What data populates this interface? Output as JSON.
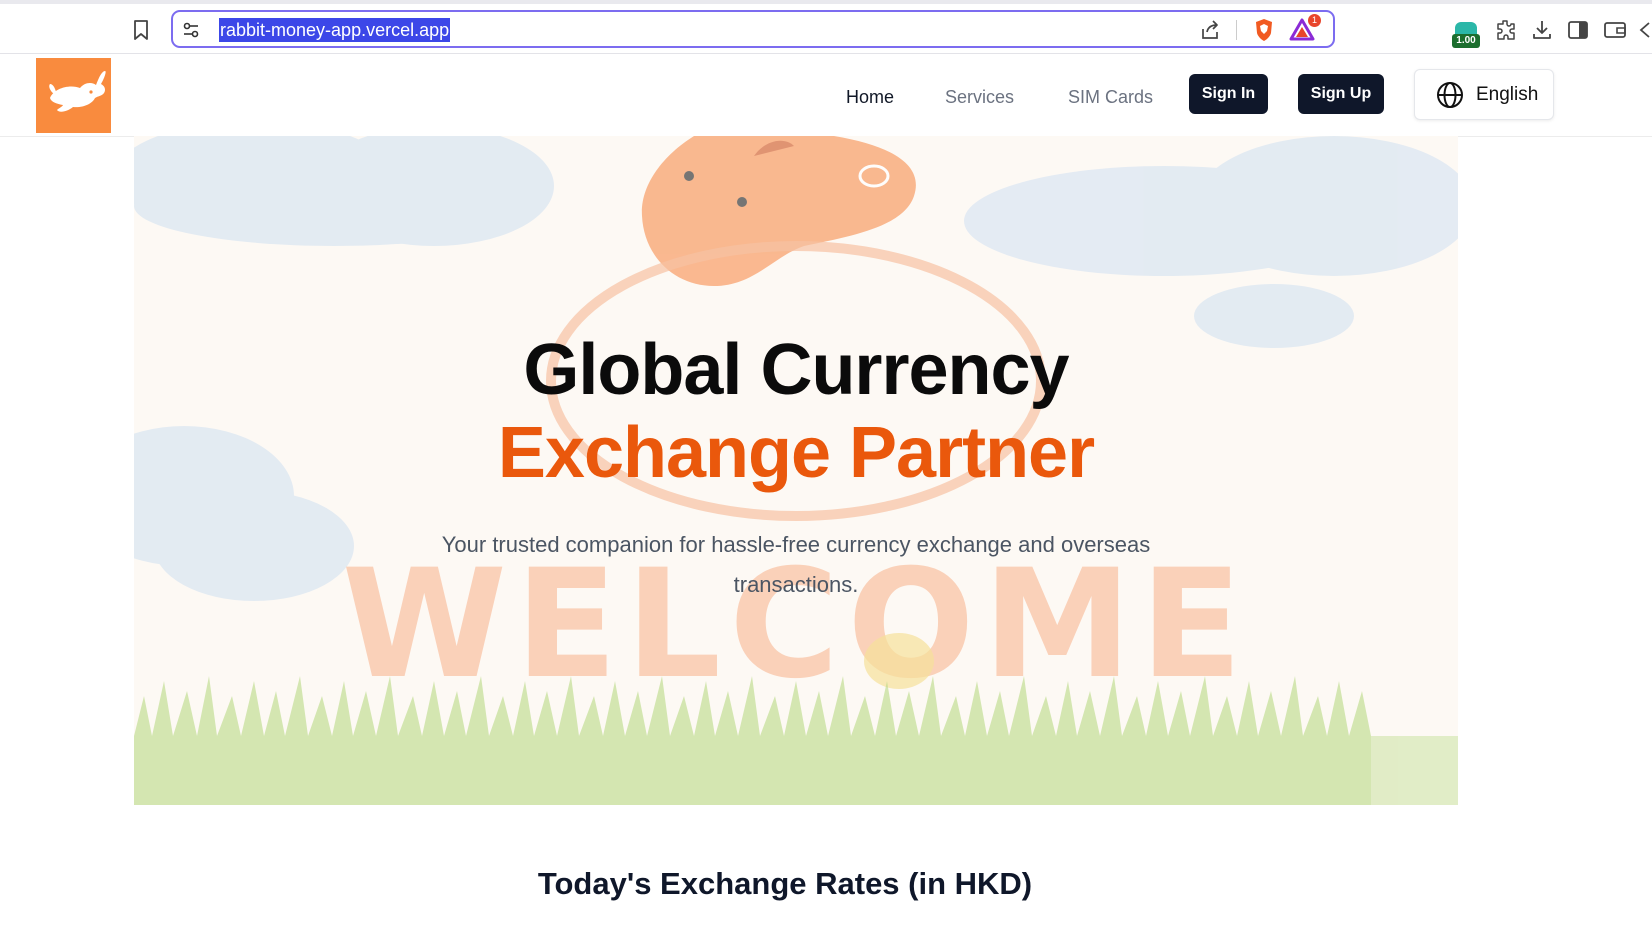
{
  "browser": {
    "url": "rabbit-money-app.vercel.app",
    "rewards_badge": "1",
    "extension_value": "1.00"
  },
  "header": {
    "nav": {
      "home": "Home",
      "services": "Services",
      "sim_cards": "SIM Cards"
    },
    "sign_in": "Sign In",
    "sign_up": "Sign Up",
    "language": "English"
  },
  "hero": {
    "title_line1": "Global Currency",
    "title_line2": "Exchange Partner",
    "subtitle_line1": "Your trusted companion for hassle-free currency exchange and overseas",
    "subtitle_line2": "transactions.",
    "background_word": "WELCOME"
  },
  "rates": {
    "heading": "Today's Exchange Rates (in HKD)"
  },
  "colors": {
    "accent_orange": "#ea580c",
    "logo_orange": "#f98b3e",
    "button_dark": "#0f172a",
    "url_highlight": "#3c47e8"
  },
  "icons": [
    "bookmark-icon",
    "site-settings-icon",
    "share-icon",
    "brave-shield-icon",
    "brave-rewards-icon",
    "extensions-icon",
    "download-icon",
    "sidebar-icon",
    "wallet-icon",
    "globe-icon",
    "rabbit-logo"
  ]
}
